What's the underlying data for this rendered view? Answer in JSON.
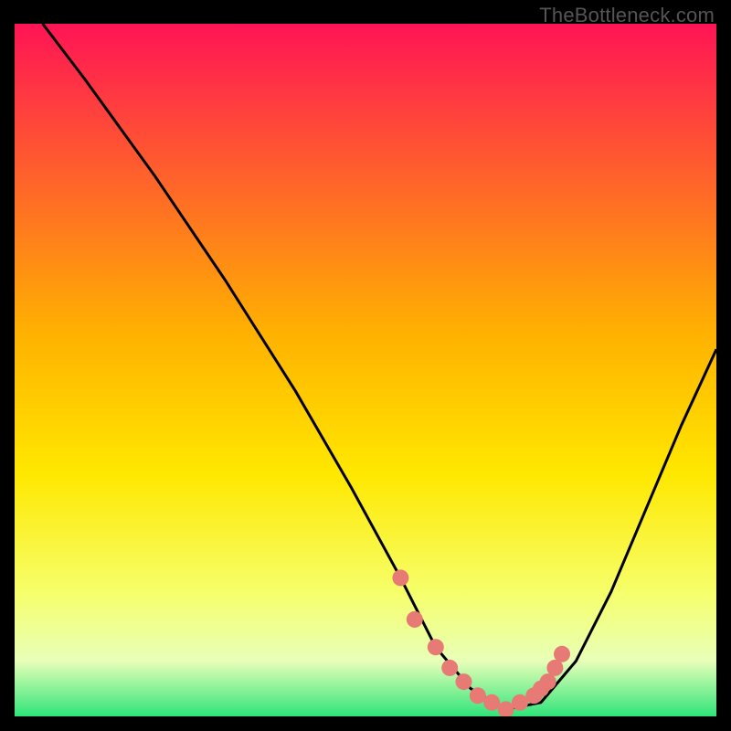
{
  "watermark": "TheBottleneck.com",
  "chart_data": {
    "type": "line",
    "title": "",
    "xlabel": "",
    "ylabel": "",
    "xlim": [
      0,
      100
    ],
    "ylim": [
      0,
      100
    ],
    "series": [
      {
        "name": "curve",
        "x": [
          4,
          10,
          20,
          30,
          40,
          48,
          55,
          60,
          65,
          70,
          75,
          80,
          85,
          90,
          95,
          100
        ],
        "y": [
          100,
          92,
          78,
          63,
          47,
          33,
          20,
          10,
          4,
          1,
          2,
          8,
          18,
          30,
          42,
          53
        ]
      }
    ],
    "highlight_points": {
      "name": "dots",
      "x": [
        55,
        57,
        60,
        62,
        64,
        66,
        68,
        70,
        72,
        74,
        75,
        76,
        77,
        78
      ],
      "y": [
        20,
        14,
        10,
        7,
        5,
        3,
        2,
        1,
        2,
        3,
        4,
        5,
        7,
        9
      ]
    },
    "gradient_stops": [
      {
        "offset": 0,
        "color": "#ff1455"
      },
      {
        "offset": 45,
        "color": "#ffb200"
      },
      {
        "offset": 65,
        "color": "#ffe800"
      },
      {
        "offset": 82,
        "color": "#f6ff6a"
      },
      {
        "offset": 92,
        "color": "#e8ffb8"
      },
      {
        "offset": 100,
        "color": "#2fe47a"
      }
    ]
  }
}
